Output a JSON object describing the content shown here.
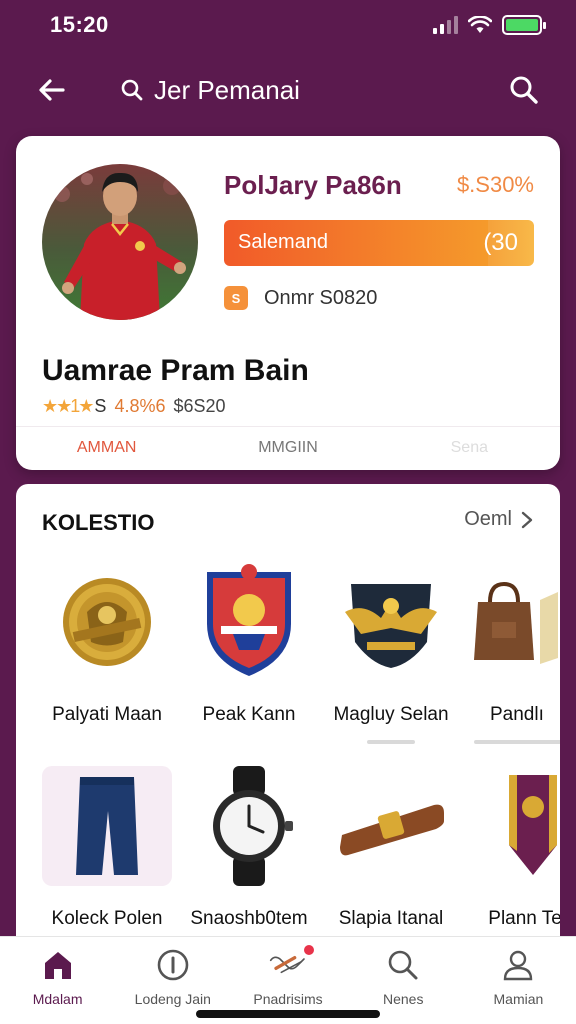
{
  "status_bar": {
    "time": "15:20"
  },
  "header": {
    "title": "Jer Pemanai"
  },
  "profile": {
    "name": "PolJary Pa86n",
    "price": "$.S30%",
    "progress_label": "Salemand",
    "progress_value": "(30",
    "progress_fraction": 0.85,
    "info_badge": "S",
    "info_text": "Onmr S0820",
    "title": "Uamrae Pram Bain",
    "rating_stars": "★★1★",
    "rating_num": "S",
    "rating_score": "4.8%6",
    "rating_price": "$6S20",
    "tabs": [
      "AMMAN",
      "MMGIIN",
      "Sena"
    ]
  },
  "collection": {
    "title": "KOLESTIO",
    "see_all": "Oeml",
    "items": [
      {
        "name": "Palyati Maan",
        "icon": "gold-medal-icon"
      },
      {
        "name": "Peak Kann",
        "icon": "team-crest-icon"
      },
      {
        "name": "Magluy Selan",
        "icon": "eagle-badge-icon"
      },
      {
        "name": "Pandlı",
        "icon": "bag-icon"
      },
      {
        "name": "Koleck Polen",
        "icon": "shorts-icon"
      },
      {
        "name": "Snaoshb0tem",
        "icon": "wristwatch-icon"
      },
      {
        "name": "Slapia Itanal",
        "icon": "captain-band-icon"
      },
      {
        "name": "Plann Tem",
        "icon": "pennant-icon"
      }
    ]
  },
  "bottom_nav": [
    {
      "label": "Mdalam",
      "icon": "home-icon",
      "active": true
    },
    {
      "label": "Lodeng Jain",
      "icon": "info-icon",
      "active": false
    },
    {
      "label": "Pnadrisims",
      "icon": "ticket-icon",
      "active": false
    },
    {
      "label": "Nenes",
      "icon": "search-icon",
      "active": false
    },
    {
      "label": "Mamian",
      "icon": "profile-icon",
      "active": false
    }
  ],
  "colors": {
    "brand": "#5b1a4e",
    "accent_orange": "#f59a2b",
    "active_tab": "#e1573d"
  }
}
